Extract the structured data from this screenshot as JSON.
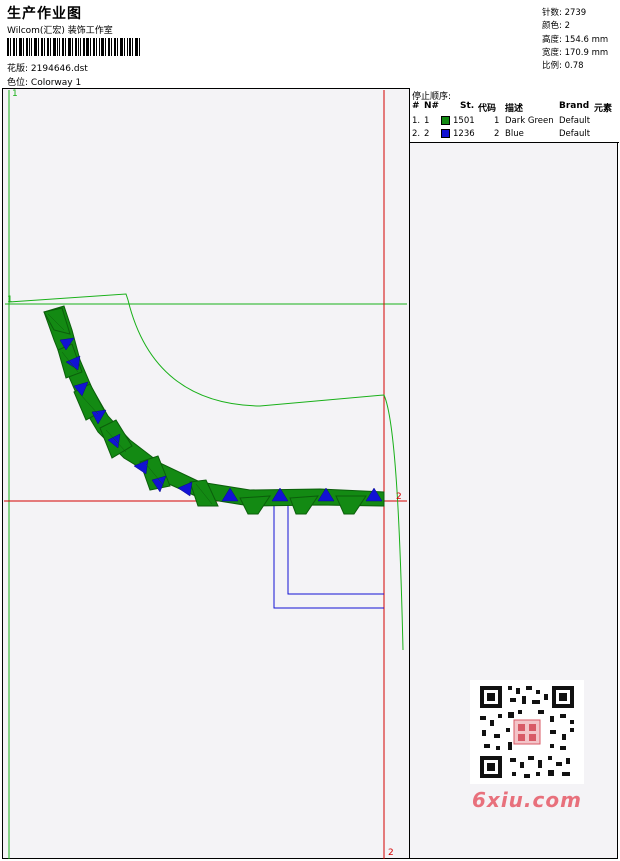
{
  "header": {
    "title": "生产作业图",
    "subtitle": "Wilcom(汇宏) 装饰工作室",
    "design_label": "花版:",
    "design_value": "2194646.dst",
    "colorway_label": "色位:",
    "colorway_value": "Colorway 1"
  },
  "stats": [
    {
      "label": "针数:",
      "value": "2739"
    },
    {
      "label": "颜色:",
      "value": "2"
    },
    {
      "label": "高度:",
      "value": "154.6 mm"
    },
    {
      "label": "宽度:",
      "value": "170.9 mm"
    },
    {
      "label": "比例:",
      "value": "0.78"
    }
  ],
  "stop_sequence": {
    "title": "停止顺序:",
    "headers": [
      "#",
      "N#",
      "St.",
      "代码",
      "描述",
      "Brand",
      "元素"
    ],
    "rows": [
      {
        "index": "1.",
        "n": "1",
        "st": "1501",
        "code": "1",
        "desc": "Dark Green",
        "brand": "Default",
        "color": "#138a13"
      },
      {
        "index": "2.",
        "n": "2",
        "st": "1236",
        "code": "2",
        "desc": "Blue",
        "brand": "Default",
        "color": "#1212d4"
      }
    ]
  },
  "markers": {
    "green_top": "1",
    "green_left": "1",
    "red_right": "2",
    "red_bottom": "2"
  },
  "colors": {
    "green": "#19b019",
    "dark_green": "#138a13",
    "blue": "#1212d4",
    "red": "#d40000"
  },
  "watermark": "6xiu.com"
}
